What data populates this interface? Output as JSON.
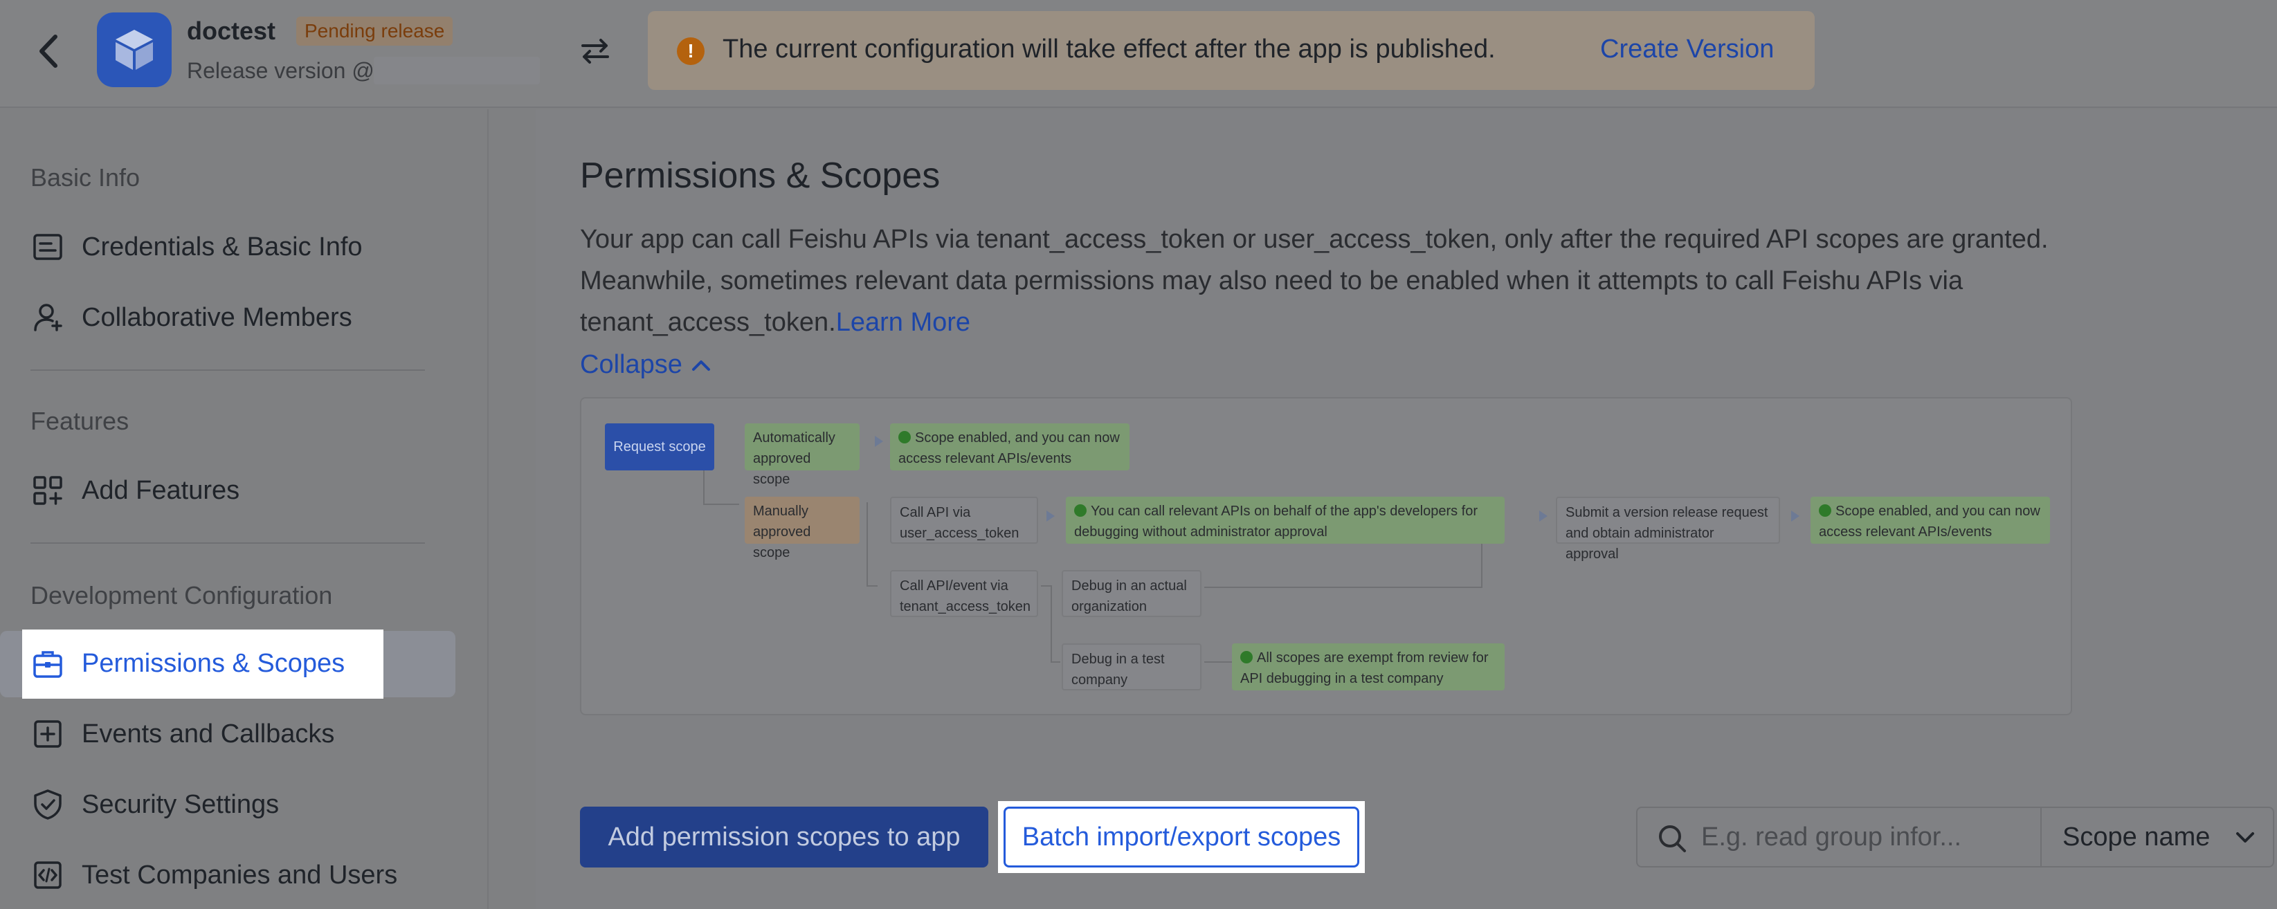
{
  "header": {
    "app_name": "doctest",
    "status_badge": "Pending release",
    "release_version_label": "Release version @",
    "notice": {
      "icon": "!",
      "text": "The current configuration will take effect after the app is published.",
      "action_label": "Create Version"
    }
  },
  "sidebar": {
    "sections": [
      {
        "title": "Basic Info"
      },
      {
        "title": "Features"
      },
      {
        "title": "Development Configuration"
      }
    ],
    "items": [
      {
        "label": "Credentials & Basic Info",
        "icon": "id-card-icon"
      },
      {
        "label": "Collaborative Members",
        "icon": "user-add-icon"
      },
      {
        "label": "Add Features",
        "icon": "grid-add-icon"
      },
      {
        "label": "Permissions & Scopes",
        "icon": "briefcase-lock-icon",
        "active": true
      },
      {
        "label": "Events and Callbacks",
        "icon": "event-add-icon"
      },
      {
        "label": "Security Settings",
        "icon": "shield-check-icon"
      },
      {
        "label": "Test Companies and Users",
        "icon": "code-box-icon"
      }
    ]
  },
  "main": {
    "title": "Permissions & Scopes",
    "description": "Your app can call Feishu APIs via tenant_access_token or user_access_token, only after the required API scopes are granted. Meanwhile, sometimes relevant data permissions may also need to be enabled when it attempts to call Feishu APIs via tenant_access_token.",
    "learn_more": "Learn More",
    "collapse_label": "Collapse",
    "diagram": {
      "request_scope": "Request scope",
      "auto_approved": "Automatically approved scope",
      "auto_result": "Scope enabled, and you can now access relevant APIs/events",
      "manual_approved": "Manually approved scope",
      "call_user_token": "Call API via user_access_token",
      "user_token_result": "You can call relevant APIs on behalf of the app's developers for debugging without administrator approval",
      "submit_release": "Submit a version release request and obtain administrator approval",
      "final_result": "Scope enabled, and you can now access relevant APIs/events",
      "call_tenant_token": "Call API/event via tenant_access_token",
      "debug_actual": "Debug in an actual organization",
      "debug_test": "Debug in a test company",
      "test_result": "All scopes are exempt from review for API debugging in a test company"
    },
    "buttons": {
      "add_scopes": "Add permission scopes to app",
      "batch": "Batch import/export scopes"
    },
    "search": {
      "placeholder": "E.g. read group infor...",
      "value": ""
    },
    "scope_filter": {
      "selected": "Scope name"
    }
  }
}
